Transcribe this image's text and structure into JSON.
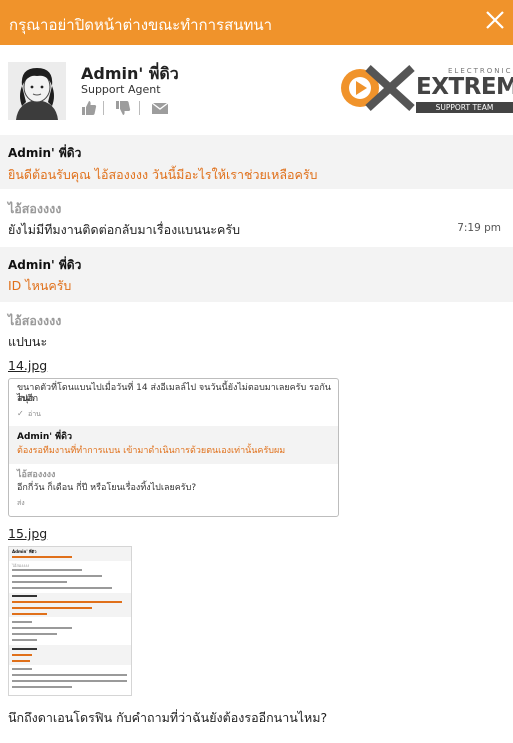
{
  "header": {
    "title": "กรุณาอย่าปิดหน้าต่างขณะทำการสนทนา"
  },
  "agent": {
    "name": "Admin' พี่ดิว",
    "role": "Support Agent",
    "brand_small": "ELECTRONIC",
    "brand_main": "EXTREME",
    "brand_team": "SUPPORT TEAM"
  },
  "messages": [
    {
      "sender": "Admin' พี่ดิว",
      "text": "ยินดีต้อนรับคุณ ไอ้สองงงง วันนี้มีอะไรให้เราช่วยเหลือครับ"
    },
    {
      "sender": "ไอ้สองงงง",
      "text": "ยังไม่มีทีมงานติดต่อกลับมาเรื่องแบนนะครับ",
      "time": "7:19 pm"
    },
    {
      "sender": "Admin' พี่ดิว",
      "text": "ID ไหนครับ"
    },
    {
      "sender": "ไอ้สองงงง",
      "text": "แปบนะ"
    },
    {
      "file": "14.jpg"
    },
    {
      "file": "15.jpg"
    },
    {
      "text": "นึกถึงดาเอนโดรฟิน กับคำถามที่ว่าฉันยังต้องรออีกนานไหม?"
    }
  ],
  "attachment1": {
    "line1": "ขนาดตัวที่โดนแบนไปเมื่อวันที่ 14 ส่งอีเมลล์ไป จนวันนี้ยังไม่ตอบมาเลยครับ รอกันสนุก",
    "line2": "ไปอีก",
    "status1": "อ่าน",
    "agent_name": "Admin' พี่ดิว",
    "agent_text": "ต้องรอทีมงานที่ทำการแบน เข้ามาดำเนินการด้วยตนเองเท่านั้นครับผม",
    "visitor_name": "ไอ้สองงงง",
    "visitor_text": "อีกกี่วัน ก็เดือน กี่ปี หรือโยนเรื่องทิ้งไปเลยครับ?",
    "status2": "ส่ง"
  },
  "attachment2": {
    "agent_name": "Admin' พี่ดิว",
    "visitor_name": "ไอ้สองงงง"
  },
  "colors": {
    "header": "#f0932b",
    "accent": "#e0701a",
    "agent_bg": "#f3f3f3"
  }
}
